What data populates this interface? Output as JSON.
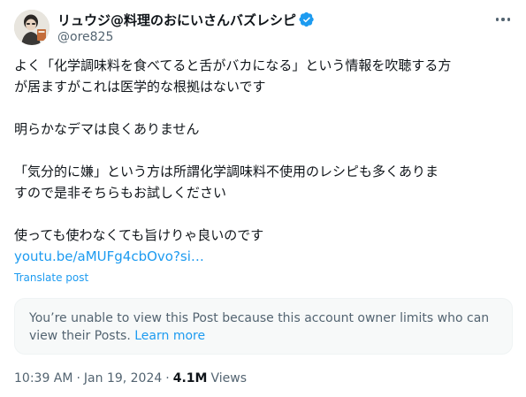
{
  "author": {
    "display_name": "リュウジ@料理のおにいさんバズレシピ",
    "handle": "@ore825",
    "verified_color": "#1d9bf0"
  },
  "post": {
    "paragraphs": [
      "よく「化学調味料を食べてると舌がバカになる」という情報を吹聴する方\nが居ますがこれは医学的な根拠はないです",
      "明らかなデマは良くありません",
      "「気分的に嫌」という方は所謂化学調味料不使用のレシピも多くありま\nすので是非そちらもお試しください",
      "使っても使わなくても旨けりゃ良いのです"
    ],
    "link_text": "youtu.be/aMUFg4cbOvo?si…",
    "translate_label": "Translate post"
  },
  "notice": {
    "text": "You’re unable to view this Post because this account owner limits who can view their Posts.",
    "learn_more": "Learn more"
  },
  "meta": {
    "time": "10:39 AM",
    "separator": "·",
    "date": "Jan 19, 2024",
    "views_count": "4.1M",
    "views_label": "Views"
  },
  "colors": {
    "accent": "#1d9bf0",
    "text": "#0f1419",
    "secondary": "#536471"
  },
  "icons": {
    "verified": "verified-badge-icon",
    "more": "more-options-icon"
  }
}
